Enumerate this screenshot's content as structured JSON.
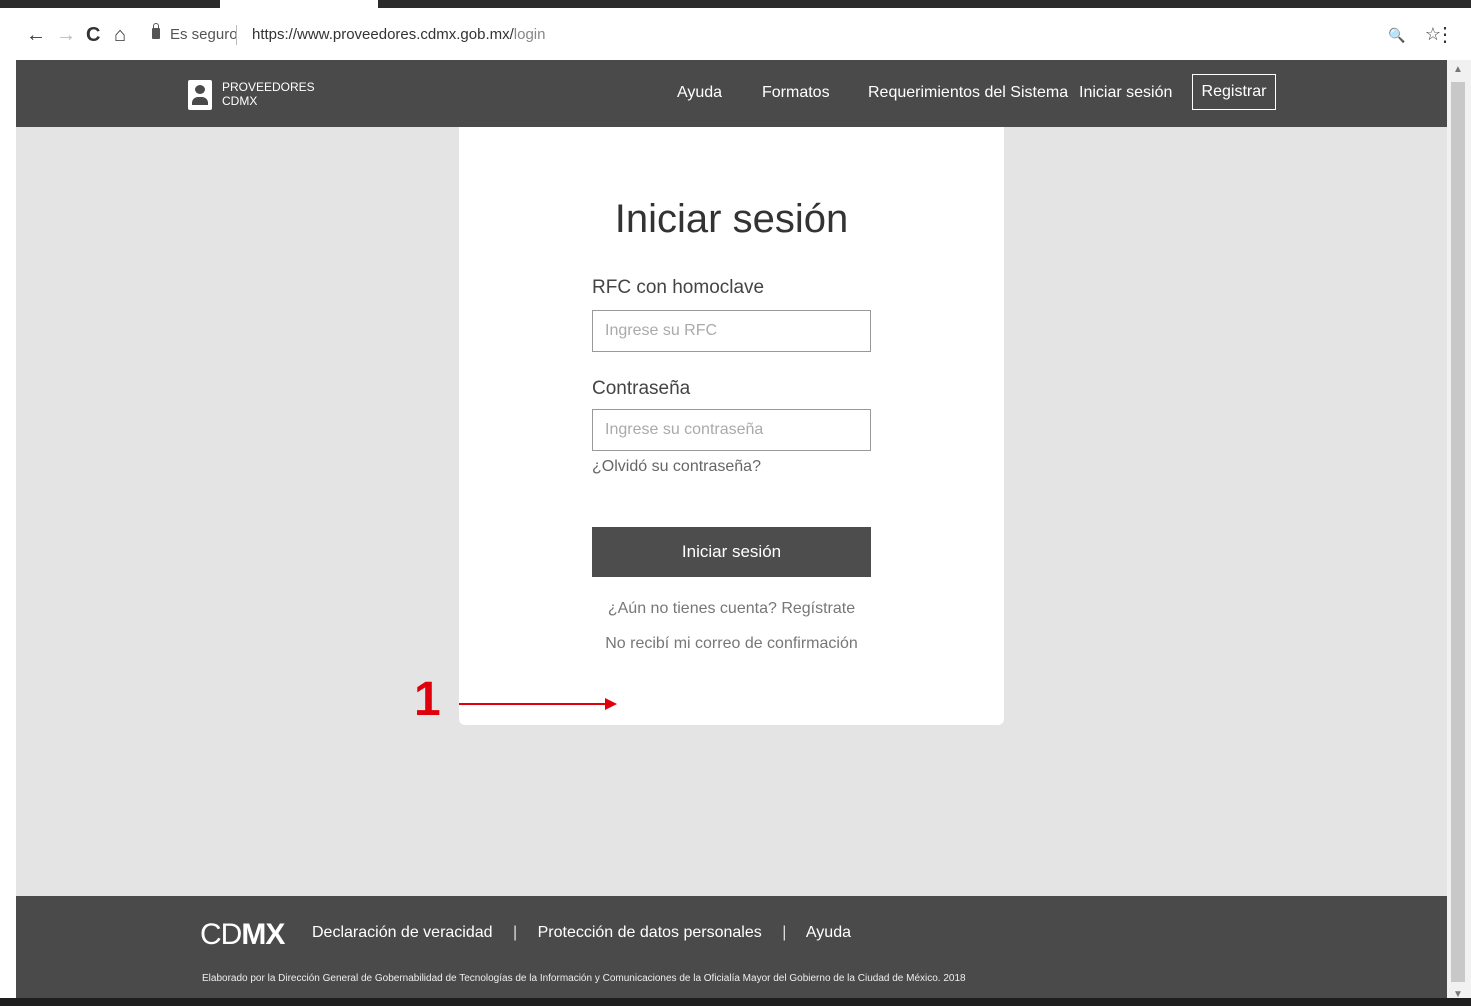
{
  "browser": {
    "back_icon": "←",
    "forward_icon": "→",
    "reload_icon": "C",
    "home_icon": "⌂",
    "secure_text": "Es seguro",
    "url_host": "https://www.proveedores.cdmx.gob.mx/",
    "url_path": "login",
    "zoom_icon": "🔍",
    "star_icon": "☆",
    "menu_icon": "⋮"
  },
  "header": {
    "logo_line1": "PROVEEDORES",
    "logo_line2": "CDMX",
    "nav": [
      "Ayuda",
      "Formatos",
      "Requerimientos del Sistema",
      "Iniciar sesión"
    ],
    "register": "Registrar"
  },
  "login": {
    "title": "Iniciar sesión",
    "rfc_label": "RFC con homoclave",
    "rfc_placeholder": "Ingrese su RFC",
    "password_label": "Contraseña",
    "password_placeholder": "Ingrese su contraseña",
    "forgot": "¿Olvidó su contraseña?",
    "submit": "Iniciar sesión",
    "no_account": "¿Aún no tienes cuenta? Regístrate",
    "no_confirmation": "No recibí mi correo de confirmación"
  },
  "annotation": {
    "number": "1",
    "color": "#e0000b"
  },
  "footer": {
    "logo_light": "CD",
    "logo_bold": "MX",
    "links": [
      "Declaración de veracidad",
      "Protección de datos personales",
      "Ayuda"
    ],
    "separator": "|",
    "note": "Elaborado por la Dirección General de Gobernabilidad de Tecnologías de la Información y Comunicaciones de la Oficialía Mayor del Gobierno de la Ciudad de México. 2018"
  }
}
